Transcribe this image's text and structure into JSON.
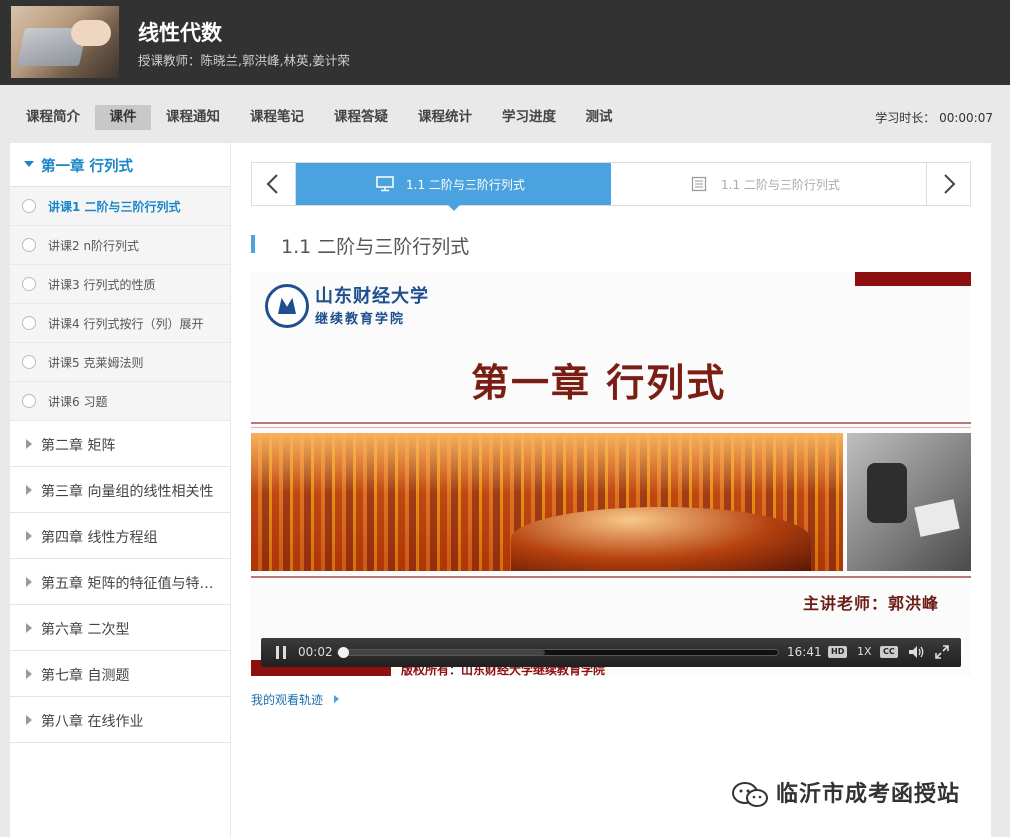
{
  "header": {
    "course_title": "线性代数",
    "teachers": "授课教师：陈晓兰,郭洪峰,林英,姜计荣"
  },
  "tabs": [
    {
      "label": "课程简介",
      "active": false
    },
    {
      "label": "课件",
      "active": true
    },
    {
      "label": "课程通知",
      "active": false
    },
    {
      "label": "课程笔记",
      "active": false
    },
    {
      "label": "课程答疑",
      "active": false
    },
    {
      "label": "课程统计",
      "active": false
    },
    {
      "label": "学习进度",
      "active": false
    },
    {
      "label": "测试",
      "active": false
    }
  ],
  "study_time": "学习时长： 00:00:07",
  "sidebar": {
    "open_chapter": "第一章 行列式",
    "lessons": [
      {
        "label": "讲课1 二阶与三阶行列式",
        "active": true
      },
      {
        "label": "讲课2 n阶行列式",
        "active": false
      },
      {
        "label": "讲课3 行列式的性质",
        "active": false
      },
      {
        "label": "讲课4 行列式按行（列）展开",
        "active": false
      },
      {
        "label": "讲课5 克莱姆法则",
        "active": false
      },
      {
        "label": "讲课6 习题",
        "active": false
      }
    ],
    "chapters": [
      "第二章 矩阵",
      "第三章 向量组的线性相关性",
      "第四章 线性方程组",
      "第五章 矩阵的特征值与特征向量",
      "第六章 二次型",
      "第七章 自测题",
      "第八章 在线作业"
    ]
  },
  "nav": {
    "active_item": "1.1 二阶与三阶行列式",
    "next_item": "1.1 二阶与三阶行列式"
  },
  "section_title": "1.1 二阶与三阶行列式",
  "slide": {
    "university": "山东财经大学",
    "college": "继续教育学院",
    "title": "第一章 行列式",
    "lecturer": "主讲老师：郭洪峰",
    "copyright": "版权所有：山东财经大学继续教育学院"
  },
  "player": {
    "current_time": "00:02",
    "duration": "16:41",
    "progress_fraction": 0.002,
    "buffered_fraction": 0.47,
    "hd_label": "HD",
    "rate_label": "1X",
    "cc_label": "CC"
  },
  "track_link": "我的观看轨迹",
  "watermark": "临沂市成考函授站",
  "colors": {
    "accent": "#4aa3df",
    "link": "#1a86c8",
    "header_bg": "#323232",
    "slide_red": "#8e0f10"
  }
}
